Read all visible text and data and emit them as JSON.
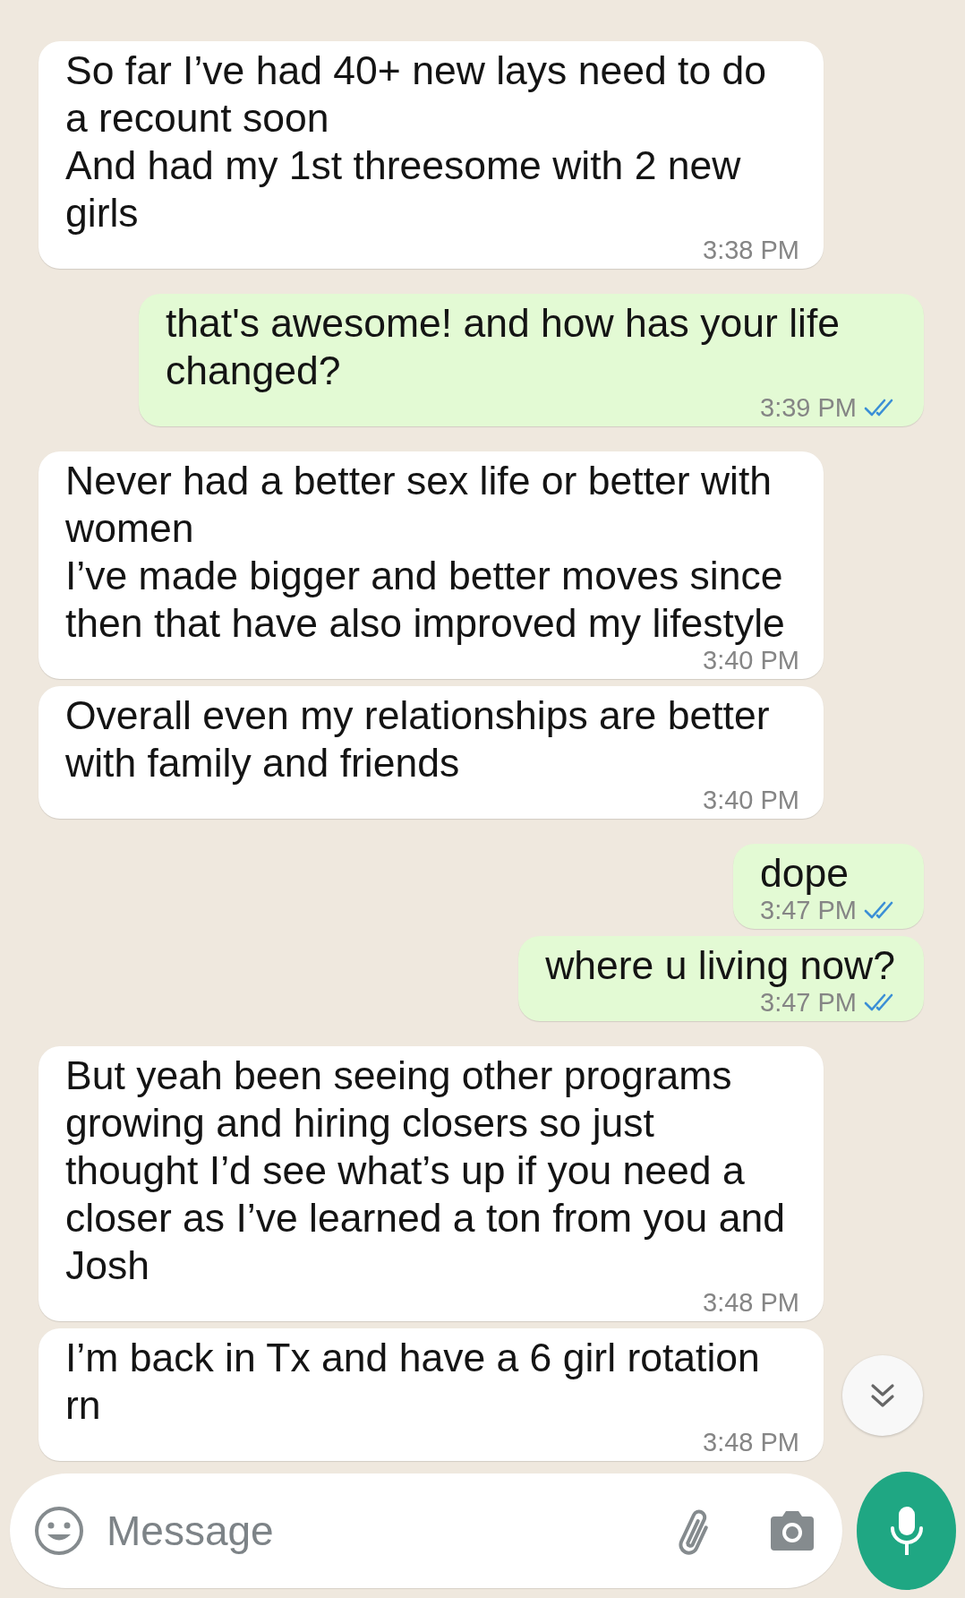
{
  "messages": [
    {
      "outgoing": false,
      "text": "So far I’ve had 40+ new lays need to do a recount soon\nAnd had my 1st threesome with 2 new girls",
      "time": "3:38 PM"
    },
    {
      "outgoing": true,
      "text": "that's awesome! and how has your life changed?",
      "time": "3:39 PM",
      "read": true
    },
    {
      "outgoing": false,
      "text": "Never had a better sex life or better with women\nI’ve made bigger and better moves since then that have also improved my lifestyle",
      "time": "3:40 PM"
    },
    {
      "outgoing": false,
      "text": "Overall even my relationships are better with family and friends",
      "time": "3:40 PM"
    },
    {
      "outgoing": true,
      "text": "dope",
      "time": "3:47 PM",
      "read": true
    },
    {
      "outgoing": true,
      "text": "where u living now?",
      "time": "3:47 PM",
      "read": true
    },
    {
      "outgoing": false,
      "text": "But yeah been seeing other programs growing and hiring closers so just thought I’d see what’s up if you need a closer as I’ve learned a ton from you and Josh",
      "time": "3:48 PM"
    },
    {
      "outgoing": false,
      "text": "I’m back in Tx and have a 6 girl rotation rn",
      "time": "3:48 PM"
    }
  ],
  "composer": {
    "placeholder": "Message"
  }
}
